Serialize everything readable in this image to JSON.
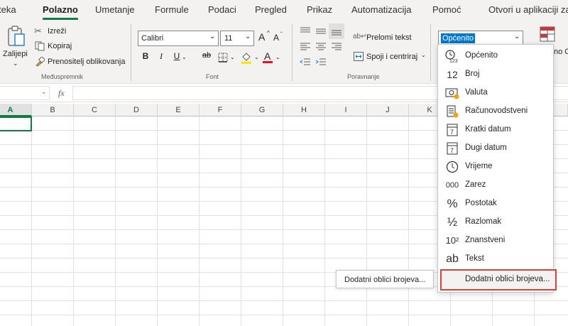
{
  "tabs": [
    "teka",
    "Polazno",
    "Umetanje",
    "Formule",
    "Podaci",
    "Pregled",
    "Prikaz",
    "Automatizacija",
    "Pomoć"
  ],
  "open_in_app": "Otvori u aplikaciji za",
  "clipboard": {
    "paste": "Zalijepi",
    "cut": "Izreži",
    "copy": "Kopiraj",
    "format_painter": "Prenositelj oblikovanja",
    "group_label": "Međuspremnik"
  },
  "font": {
    "name": "Calibri",
    "size": "11",
    "grow": "A",
    "shrink": "A",
    "bold": "B",
    "italic": "I",
    "underline": "U",
    "strike": "ab",
    "font_color_glyph": "A",
    "group_label": "Font"
  },
  "alignment": {
    "wrap_text": "Prelomi tekst",
    "merge_center": "Spoji i centriraj",
    "group_label": "Poravnanje"
  },
  "number": {
    "format_value": "Općenito",
    "overflow_text": "no C"
  },
  "formula_bar": {
    "fx": "fx"
  },
  "columns": [
    "A",
    "B",
    "C",
    "D",
    "E",
    "F",
    "G",
    "H",
    "I",
    "J",
    "K",
    "L",
    "N"
  ],
  "number_formats": [
    {
      "label": "Općenito",
      "icon": "clock-123-icon",
      "glyph": "🕒"
    },
    {
      "label": "Broj",
      "icon": "number-12-icon",
      "glyph": "12"
    },
    {
      "label": "Valuta",
      "icon": "currency-icon",
      "glyph": "💱"
    },
    {
      "label": "Računovodstveni",
      "icon": "accounting-icon",
      "glyph": "🧾"
    },
    {
      "label": "Kratki datum",
      "icon": "calendar-short-icon",
      "glyph": "📅"
    },
    {
      "label": "Dugi datum",
      "icon": "calendar-long-icon",
      "glyph": "📅"
    },
    {
      "label": "Vrijeme",
      "icon": "clock-icon",
      "glyph": "🕒"
    },
    {
      "label": "Zarez",
      "icon": "comma-000-icon",
      "glyph": "000"
    },
    {
      "label": "Postotak",
      "icon": "percent-icon",
      "glyph": "%"
    },
    {
      "label": "Razlomak",
      "icon": "fraction-icon",
      "glyph": "½"
    },
    {
      "label": "Znanstveni",
      "icon": "scientific-icon",
      "glyph": "10²"
    },
    {
      "label": "Tekst",
      "icon": "text-ab-icon",
      "glyph": "ab"
    }
  ],
  "more_formats": "Dodatni oblici brojeva...",
  "tooltip": "Dodatni oblici brojeva...",
  "colors": {
    "accent": "#107c41",
    "highlight_border": "#d9413a",
    "font_color_bar": "#e81123",
    "fill_color_bar": "#ffe600"
  }
}
